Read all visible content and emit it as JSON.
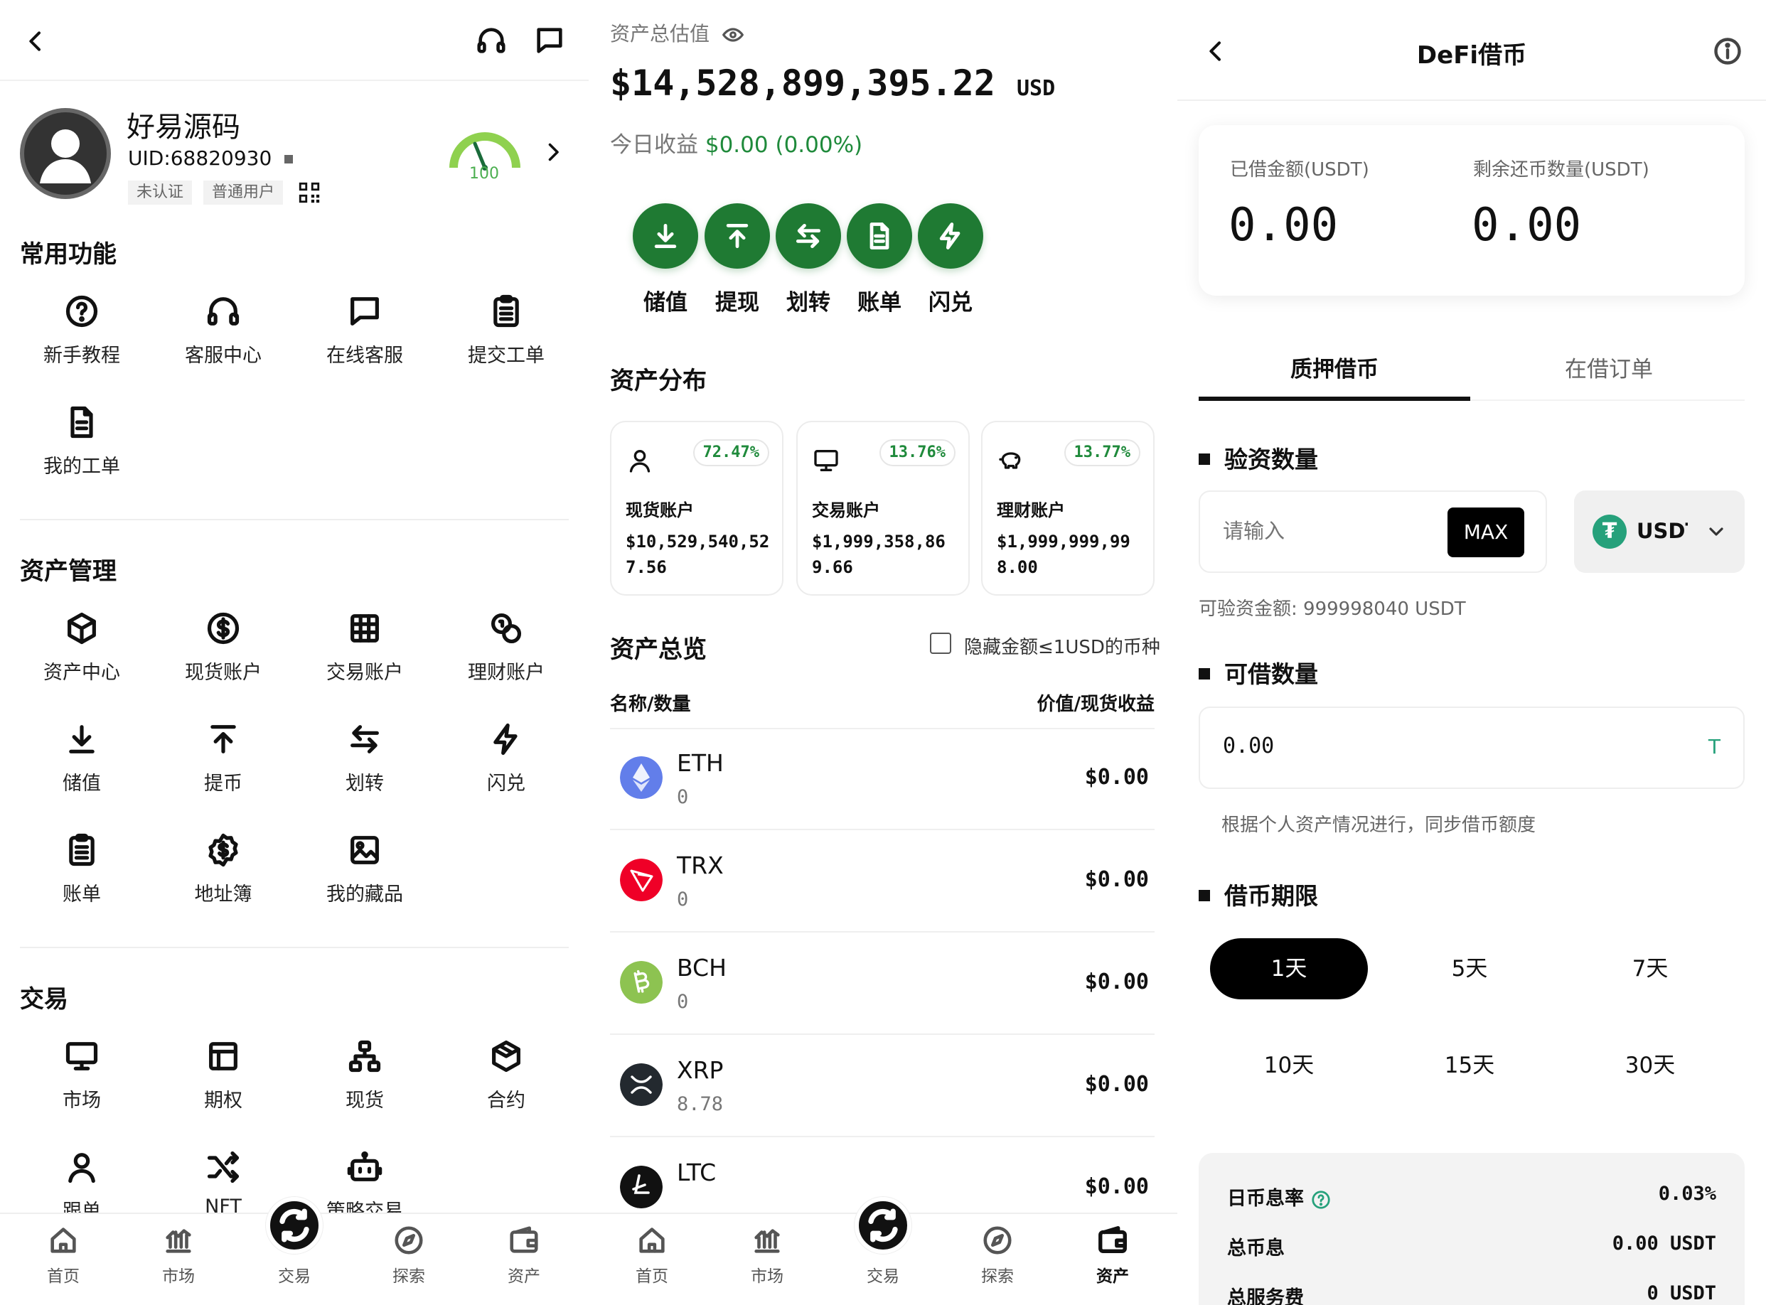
{
  "panel1": {
    "header": {
      "back_icon": "chevron-left-icon",
      "icons": [
        "headset-icon",
        "chat-icon"
      ]
    },
    "profile": {
      "name": "好易源码",
      "uid": "UID:68820930",
      "tags": [
        "未认证",
        "普通用户"
      ],
      "score": "100"
    },
    "sections": [
      {
        "title": "常用功能",
        "items": [
          "新手教程",
          "客服中心",
          "在线客服",
          "提交工单",
          "我的工单"
        ]
      },
      {
        "title": "资产管理",
        "items": [
          "资产中心",
          "现货账户",
          "交易账户",
          "理财账户",
          "储值",
          "提币",
          "划转",
          "闪兑",
          "账单",
          "地址簿",
          "我的藏品"
        ]
      },
      {
        "title": "交易",
        "items": [
          "市场",
          "期权",
          "现货",
          "合约",
          "跟单",
          "NFT",
          "策略交易"
        ]
      }
    ]
  },
  "tabbar": {
    "items": [
      "首页",
      "市场",
      "交易",
      "探索",
      "资产"
    ]
  },
  "panel2": {
    "total_label": "资产总估值",
    "total_value": "$14,528,899,395.22",
    "total_unit": "USD",
    "today_label": "今日收益",
    "today_value": "$0.00",
    "today_pct": "(0.00%)",
    "actions": [
      "储值",
      "提现",
      "划转",
      "账单",
      "闪兑"
    ],
    "distribution_title": "资产分布",
    "accounts": [
      {
        "pct": "72.47%",
        "name": "现货账户",
        "value": "$10,529,540,527.56",
        "icon": "user-icon"
      },
      {
        "pct": "13.76%",
        "name": "交易账户",
        "value": "$1,999,358,869.66",
        "icon": "monitor-icon"
      },
      {
        "pct": "13.77%",
        "name": "理财账户",
        "value": "$1,999,999,998.00",
        "icon": "piggy-bank-icon"
      }
    ],
    "overview_title": "资产总览",
    "hide_small_label": "隐藏金额≤1USD的币种",
    "col_left": "名称/数量",
    "col_right": "价值/现货收益",
    "coins": [
      {
        "symbol": "ETH",
        "qty": "0",
        "value": "$0.00",
        "color": "#627eea"
      },
      {
        "symbol": "TRX",
        "qty": "0",
        "value": "$0.00",
        "color": "#ef0027"
      },
      {
        "symbol": "BCH",
        "qty": "0",
        "value": "$0.00",
        "color": "#8dc351"
      },
      {
        "symbol": "XRP",
        "qty": "8.78",
        "value": "$0.00",
        "color": "#23292f"
      },
      {
        "symbol": "LTC",
        "qty": "",
        "value": "$0.00",
        "color": "#111111"
      }
    ],
    "active_tab": "资产"
  },
  "panel3": {
    "title": "DeFi借币",
    "borrowed_label": "已借金额(USDT)",
    "borrowed_value": "0.00",
    "remaining_label": "剩余还币数量(USDT)",
    "remaining_value": "0.00",
    "tabs": [
      "质押借币",
      "在借订单"
    ],
    "verify_title": "验资数量",
    "input_placeholder": "请输入",
    "max_label": "MAX",
    "coin_select": "USDT",
    "verifiable_text": "可验资金额: 999998040 USDT",
    "borrowable_title": "可借数量",
    "borrowable_value": "0.00",
    "borrowable_unit": "T",
    "note": "根据个人资产情况进行，同步借币额度",
    "term_title": "借币期限",
    "terms": [
      "1天",
      "5天",
      "7天",
      "10天",
      "15天",
      "30天"
    ],
    "selected_term": "1天",
    "rates": [
      {
        "label": "日币息率",
        "value": "0.03%"
      },
      {
        "label": "总币息",
        "value": "0.00 USDT"
      },
      {
        "label": "总服务费",
        "value": "0 USDT"
      }
    ]
  },
  "colors": {
    "primary_green": "#1f7a33",
    "profit_green": "#1f8a3b",
    "usdt_green": "#26a17b",
    "black": "#000000"
  }
}
